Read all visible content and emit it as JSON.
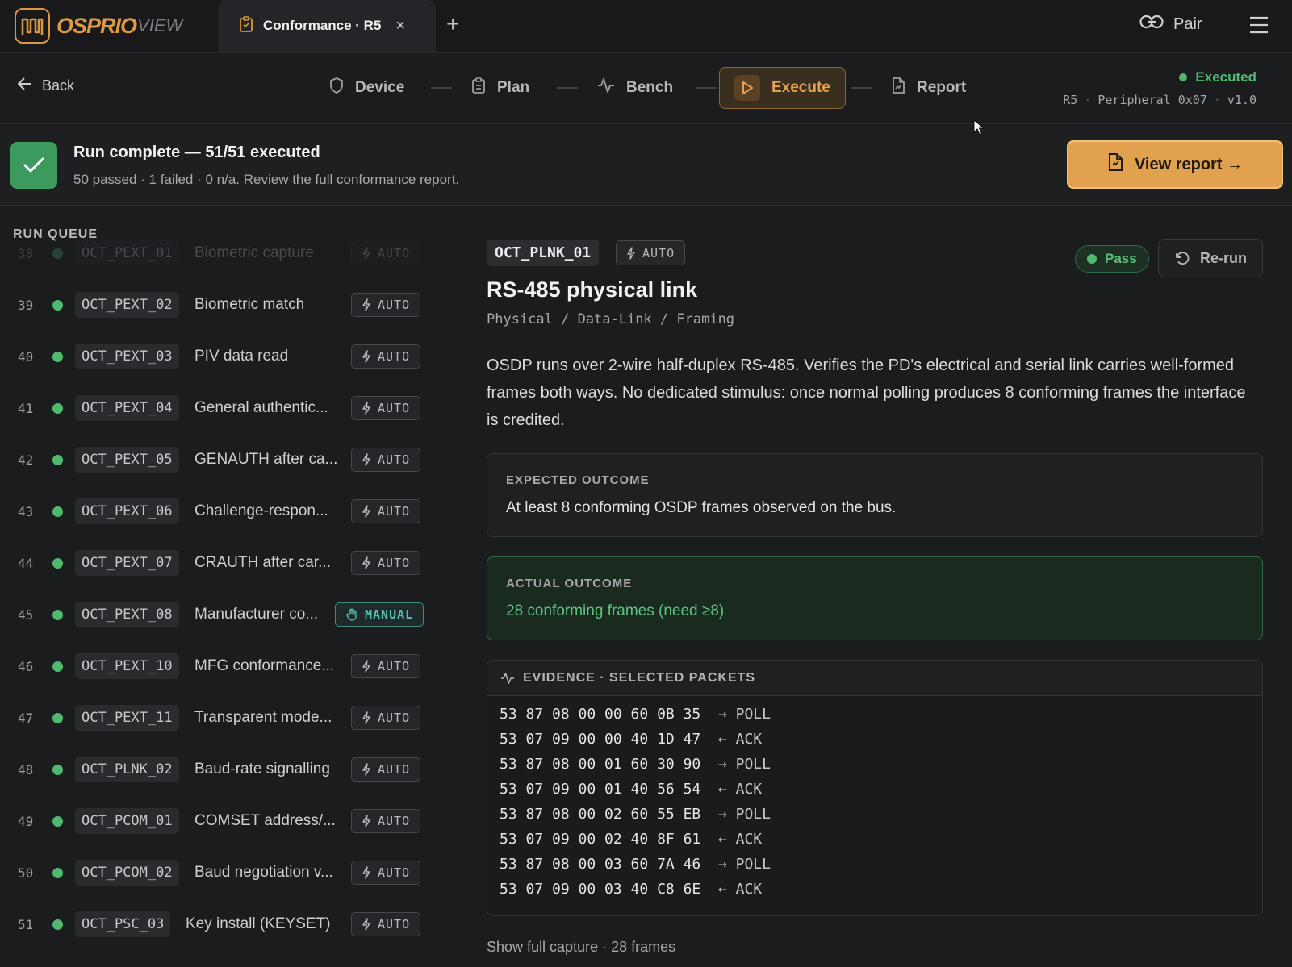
{
  "app": {
    "logo_primary": "OSPRIO",
    "logo_secondary": "VIEW"
  },
  "tab": {
    "title": "Conformance · R5",
    "close": "×",
    "add": "+"
  },
  "header": {
    "pair_label": "Pair"
  },
  "nav": {
    "back_label": "Back",
    "steps": [
      {
        "label": "Device"
      },
      {
        "label": "Plan"
      },
      {
        "label": "Bench"
      },
      {
        "label": "Execute"
      },
      {
        "label": "Report"
      }
    ],
    "active_step": "Execute",
    "status": "Executed",
    "status_color": "#4fb970",
    "device": {
      "profile": "R5",
      "peripheral": "Peripheral 0x07",
      "version": "v1.0",
      "sep": "·"
    }
  },
  "banner": {
    "title": "Run complete — 51/51 executed",
    "subtitle": "50 passed · 1 failed · 0 n/a. Review the full conformance report.",
    "button": "View report →"
  },
  "queue": {
    "title": "RUN QUEUE",
    "items": [
      {
        "num": "38",
        "id": "OCT_PEXT_01",
        "name": "Biometric capture",
        "mode": "AUTO"
      },
      {
        "num": "39",
        "id": "OCT_PEXT_02",
        "name": "Biometric match",
        "mode": "AUTO"
      },
      {
        "num": "40",
        "id": "OCT_PEXT_03",
        "name": "PIV data read",
        "mode": "AUTO"
      },
      {
        "num": "41",
        "id": "OCT_PEXT_04",
        "name": "General authentic...",
        "mode": "AUTO"
      },
      {
        "num": "42",
        "id": "OCT_PEXT_05",
        "name": "GENAUTH after ca...",
        "mode": "AUTO"
      },
      {
        "num": "43",
        "id": "OCT_PEXT_06",
        "name": "Challenge-respon...",
        "mode": "AUTO"
      },
      {
        "num": "44",
        "id": "OCT_PEXT_07",
        "name": "CRAUTH after car...",
        "mode": "AUTO"
      },
      {
        "num": "45",
        "id": "OCT_PEXT_08",
        "name": "Manufacturer co...",
        "mode": "MANUAL"
      },
      {
        "num": "46",
        "id": "OCT_PEXT_10",
        "name": "MFG conformance...",
        "mode": "AUTO"
      },
      {
        "num": "47",
        "id": "OCT_PEXT_11",
        "name": "Transparent mode...",
        "mode": "AUTO"
      },
      {
        "num": "48",
        "id": "OCT_PLNK_02",
        "name": "Baud-rate signalling",
        "mode": "AUTO"
      },
      {
        "num": "49",
        "id": "OCT_PCOM_01",
        "name": "COMSET address/...",
        "mode": "AUTO"
      },
      {
        "num": "50",
        "id": "OCT_PCOM_02",
        "name": "Baud negotiation v...",
        "mode": "AUTO"
      },
      {
        "num": "51",
        "id": "OCT_PSC_03",
        "name": "Key install (KEYSET)",
        "mode": "AUTO"
      }
    ]
  },
  "detail": {
    "id": "OCT_PLNK_01",
    "mode": "AUTO",
    "result": "Pass",
    "rerun": "Re-run",
    "title": "RS-485 physical link",
    "path": "Physical / Data-Link / Framing",
    "description": "OSDP runs over 2-wire half-duplex RS-485. Verifies the PD's electrical and serial link carries well-formed frames both ways. No dedicated stimulus: once normal polling produces 8 conforming frames the interface is credited.",
    "expected_label": "EXPECTED OUTCOME",
    "expected": "At least 8 conforming OSDP frames observed on the bus.",
    "actual_label": "ACTUAL OUTCOME",
    "actual": "28 conforming frames (need ≥8)",
    "evidence_label": "EVIDENCE · SELECTED PACKETS",
    "packets": [
      {
        "bytes": "53 87 08 00 00 60 0B 35",
        "dir": "→ POLL"
      },
      {
        "bytes": "53 07 09 00 00 40 1D 47",
        "dir": "← ACK"
      },
      {
        "bytes": "53 87 08 00 01 60 30 90",
        "dir": "→ POLL"
      },
      {
        "bytes": "53 07 09 00 01 40 56 54",
        "dir": "← ACK"
      },
      {
        "bytes": "53 87 08 00 02 60 55 EB",
        "dir": "→ POLL"
      },
      {
        "bytes": "53 07 09 00 02 40 8F 61",
        "dir": "← ACK"
      },
      {
        "bytes": "53 87 08 00 03 60 7A 46",
        "dir": "→ POLL"
      },
      {
        "bytes": "53 07 09 00 03 40 C8 6E",
        "dir": "← ACK"
      }
    ],
    "show_capture": "Show full capture · 28 frames"
  },
  "colors": {
    "accent": "#e1a14f",
    "pass": "#4fb970",
    "manual": "#56c1b5"
  }
}
